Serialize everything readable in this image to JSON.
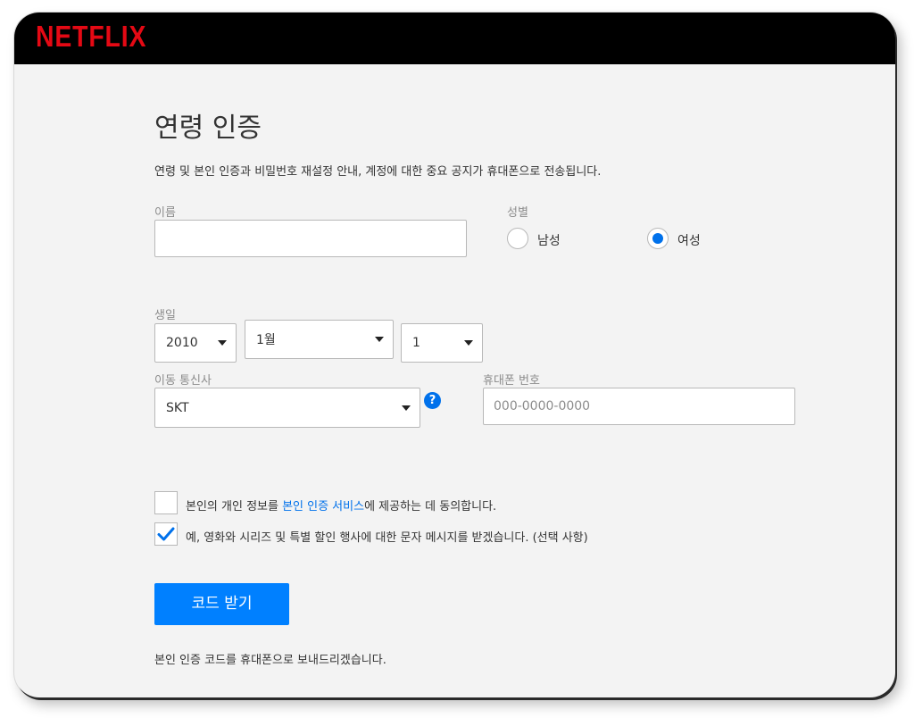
{
  "header": {
    "logo_text": "NETFLIX",
    "brand_color": "#e50914"
  },
  "form": {
    "title": "연령 인증",
    "description": "연령 및 본인 인증과 비밀번호 재설정 안내, 계정에 대한 중요 공지가 휴대폰으로 전송됩니다.",
    "name": {
      "label": "이름",
      "value": ""
    },
    "gender": {
      "label": "성별",
      "options": [
        {
          "label": "남성",
          "selected": false
        },
        {
          "label": "여성",
          "selected": true
        }
      ]
    },
    "birthdate": {
      "label": "생일",
      "year": "2010",
      "month": "1월",
      "day": "1"
    },
    "carrier": {
      "label": "이동 통신사",
      "value": "SKT",
      "help_icon": "?"
    },
    "phone": {
      "label": "휴대폰 번호",
      "placeholder": "000-0000-0000"
    },
    "consents": [
      {
        "checked": false,
        "text_before": "본인의 개인 정보를 ",
        "link": "본인 인증 서비스",
        "text_after": "에 제공하는 데 동의합니다."
      },
      {
        "checked": true,
        "text": "예, 영화와 시리즈 및 특별 할인 행사에 대한 문자 메시지를 받겠습니다. (선택 사항)"
      }
    ],
    "submit_label": "코드 받기",
    "footer_note": "본인 인증 코드를 휴대폰으로 보내드리겠습니다."
  },
  "colors": {
    "accent": "#0071eb",
    "button": "#0080ff",
    "background": "#f3f3f3",
    "header": "#000000"
  }
}
